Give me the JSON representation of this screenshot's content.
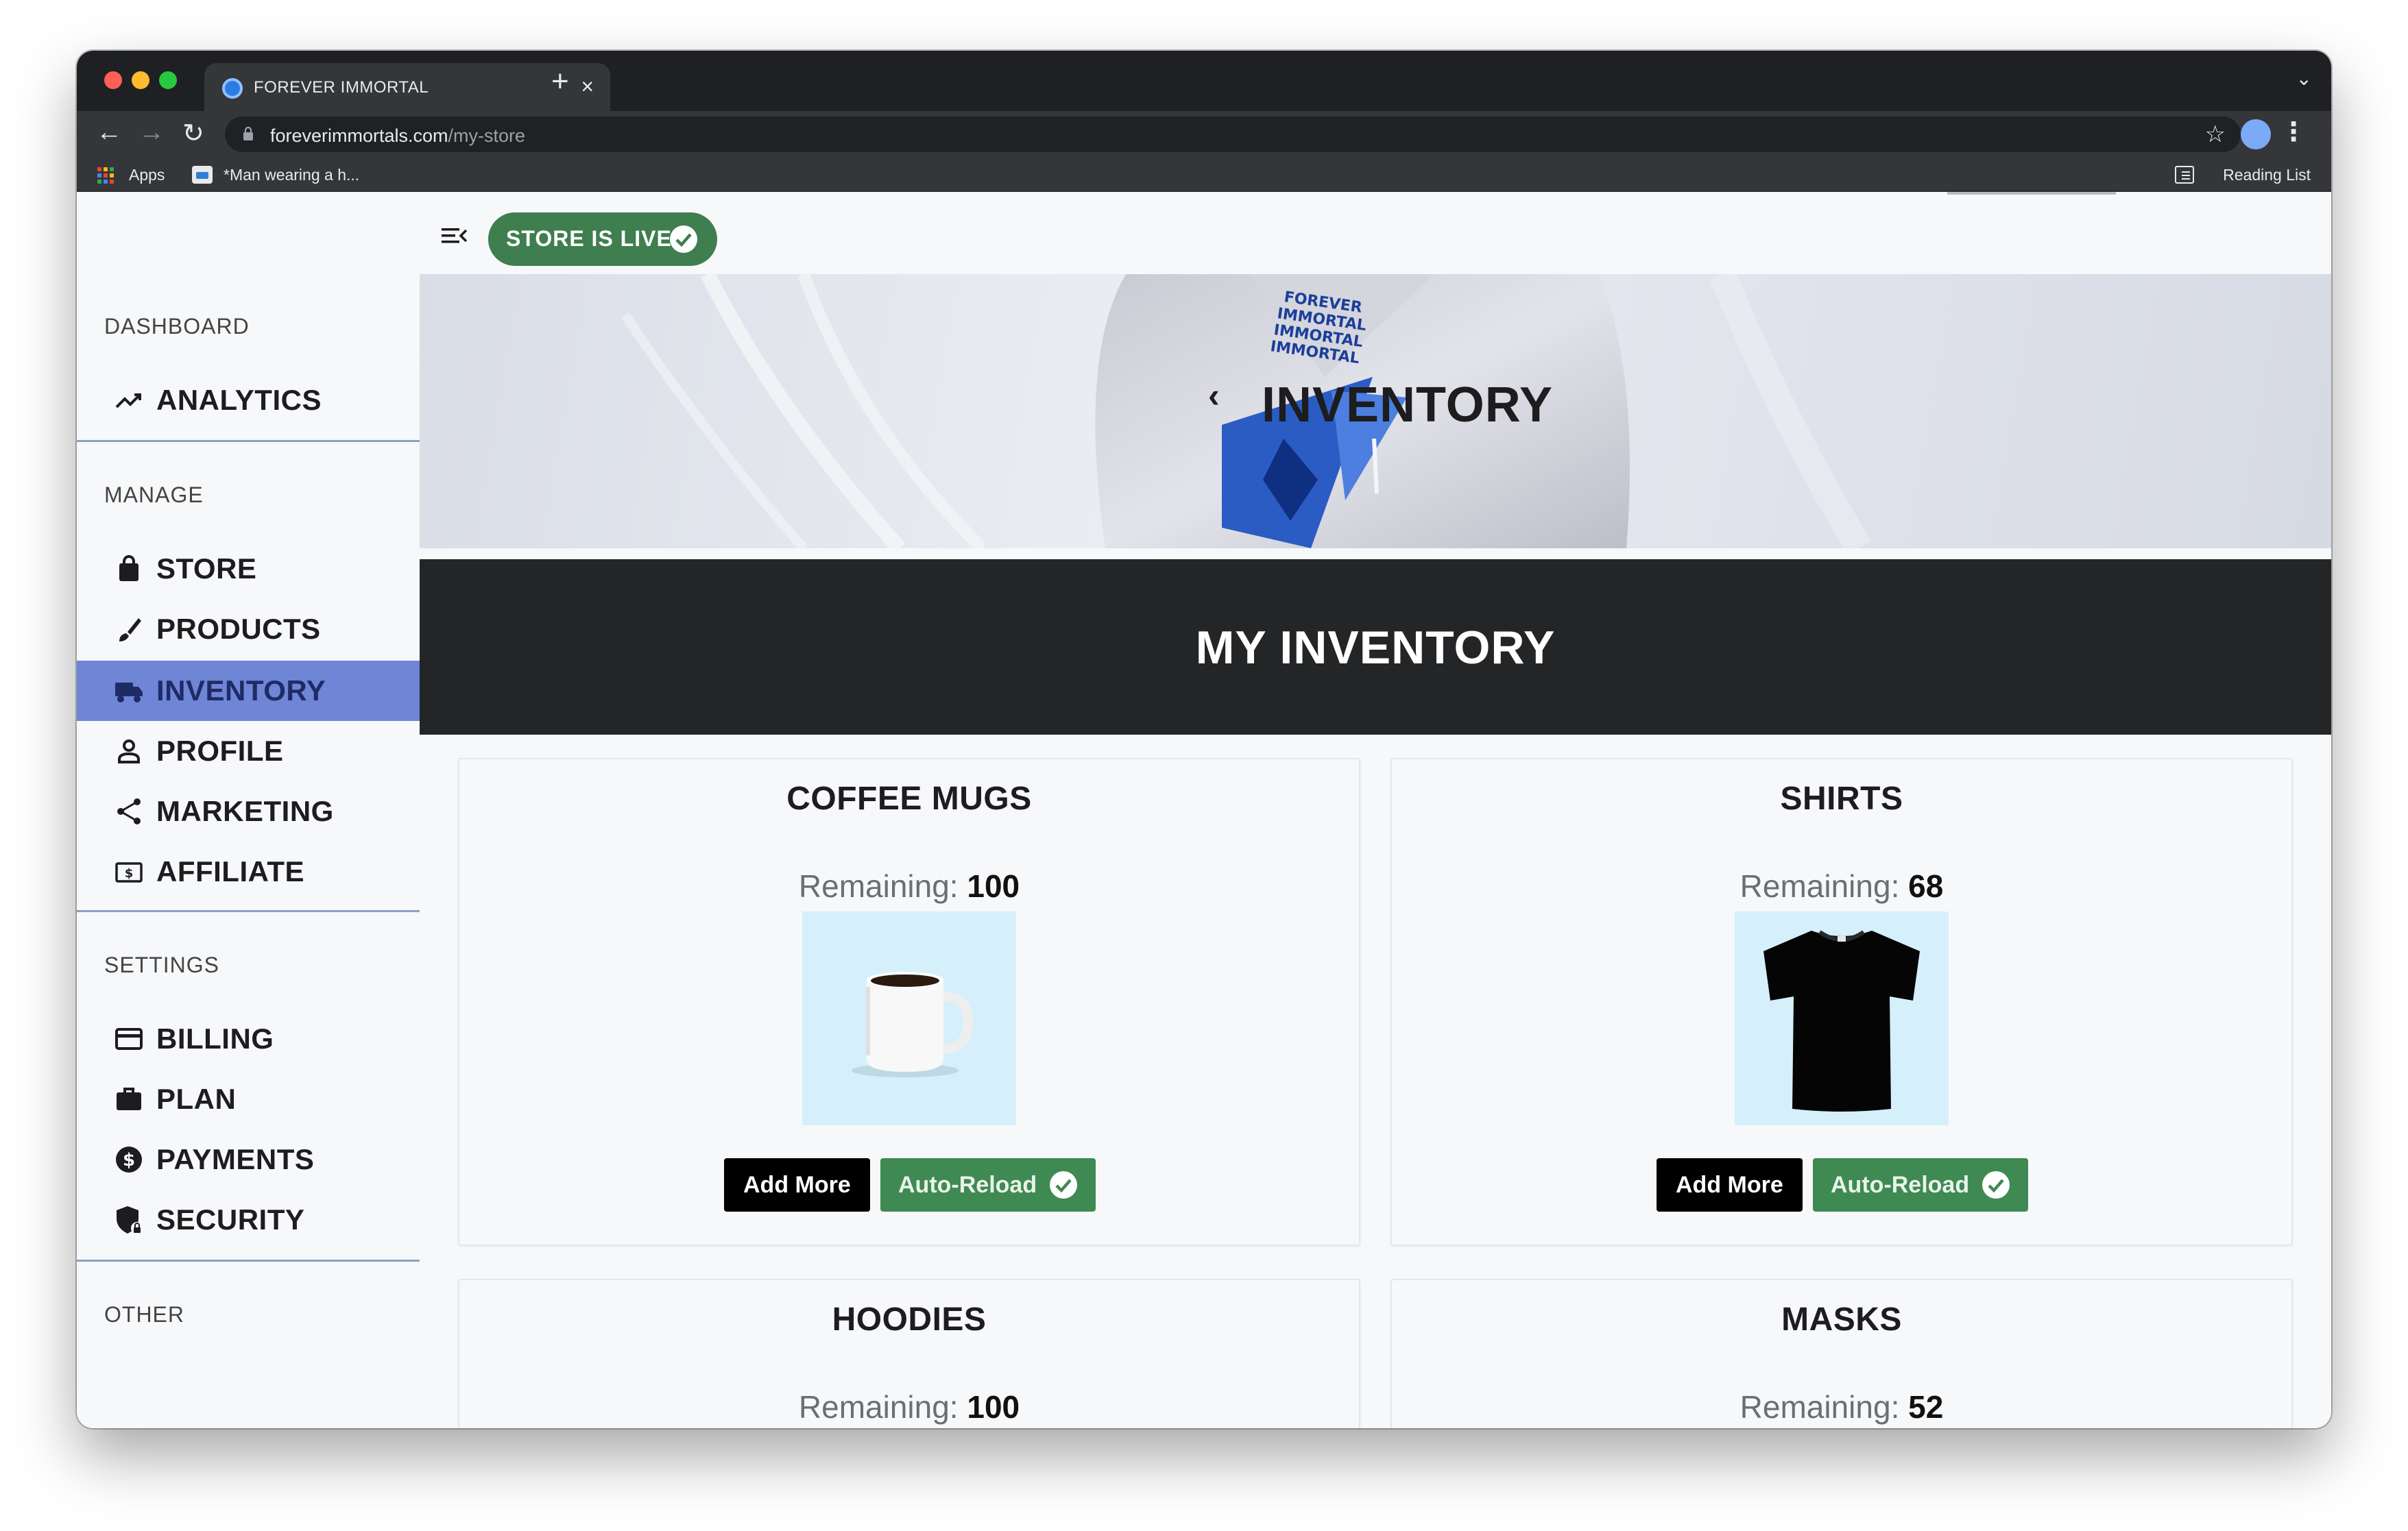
{
  "browser": {
    "tab_title": "FOREVER IMMORTAL",
    "tab_close": "×",
    "new_tab": "+",
    "tab_overflow": "⌄",
    "url_domain": "foreverimmortals.com",
    "url_path": "/my-store",
    "bookmarks": [
      {
        "label": "Apps",
        "icon": "apps-grid-icon"
      },
      {
        "label": "*Man wearing a h...",
        "icon": "image-bookmark-icon"
      }
    ],
    "reading_list": "Reading List",
    "nav_icons": {
      "back": "←",
      "forward": "→",
      "reload": "↻",
      "star": "☆",
      "menu": "⋮"
    }
  },
  "header": {
    "store_status": "STORE IS LIVE",
    "status_color": "#3f7e4f"
  },
  "hero": {
    "title": "INVENTORY",
    "back_icon": "‹"
  },
  "banner": {
    "title": "MY INVENTORY"
  },
  "sidebar": {
    "sections": [
      {
        "title": "DASHBOARD",
        "items": [
          {
            "label": "ANALYTICS",
            "icon": "trending-up-icon"
          }
        ]
      },
      {
        "title": "MANAGE",
        "items": [
          {
            "label": "STORE",
            "icon": "shopping-bag-icon"
          },
          {
            "label": "PRODUCTS",
            "icon": "brush-icon"
          },
          {
            "label": "INVENTORY",
            "icon": "truck-icon",
            "active": true
          },
          {
            "label": "PROFILE",
            "icon": "person-icon"
          },
          {
            "label": "MARKETING",
            "icon": "share-icon"
          },
          {
            "label": "AFFILIATE",
            "icon": "dollar-bill-icon"
          }
        ]
      },
      {
        "title": "SETTINGS",
        "items": [
          {
            "label": "BILLING",
            "icon": "credit-card-icon"
          },
          {
            "label": "PLAN",
            "icon": "briefcase-icon"
          },
          {
            "label": "PAYMENTS",
            "icon": "dollar-circle-icon"
          },
          {
            "label": "SECURITY",
            "icon": "shield-lock-icon"
          }
        ]
      },
      {
        "title": "OTHER",
        "items": []
      }
    ],
    "active_color": "#6f86d6"
  },
  "inventory": {
    "remaining_label": "Remaining:",
    "add_more_label": "Add More",
    "auto_reload_label": "Auto-Reload",
    "items": [
      {
        "name": "COFFEE MUGS",
        "remaining": "100",
        "image": "coffee-mug"
      },
      {
        "name": "SHIRTS",
        "remaining": "68",
        "image": "black-tshirt"
      },
      {
        "name": "HOODIES",
        "remaining": "100",
        "image": "hoodie"
      },
      {
        "name": "MASKS",
        "remaining": "52",
        "image": "mask"
      }
    ]
  }
}
